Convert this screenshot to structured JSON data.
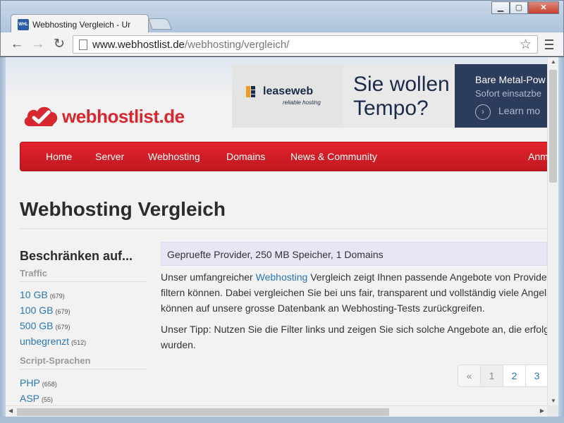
{
  "browser": {
    "tab_title": "Webhosting Vergleich - Ur",
    "favicon_text": "WHL",
    "url_domain": "www.webhostlist.de",
    "url_path": "/webhosting/vergleich/"
  },
  "site": {
    "logo_text": "webhostlist.de",
    "brand_color": "#d7282f"
  },
  "banner": {
    "brand": "leaseweb",
    "tagline": "reliable hosting",
    "headline1": "Sie wollen",
    "headline2": "Tempo?",
    "right1": "Bare Metal-Pow",
    "right2": "Sofort einsatzbe",
    "right3": "Learn mo"
  },
  "nav": {
    "items": [
      "Home",
      "Server",
      "Webhosting",
      "Domains",
      "News & Community"
    ],
    "right": "Anm"
  },
  "page_title": "Webhosting Vergleich",
  "sidebar": {
    "title": "Beschränken auf...",
    "traffic_head": "Traffic",
    "traffic": [
      {
        "label": "10 GB",
        "count": "(679)"
      },
      {
        "label": "100 GB",
        "count": "(679)"
      },
      {
        "label": "500 GB",
        "count": "(679)"
      },
      {
        "label": "unbegrenzt",
        "count": "(512)"
      }
    ],
    "script_head": "Script-Sprachen",
    "scripts": [
      {
        "label": "PHP",
        "count": "(658)"
      },
      {
        "label": "ASP",
        "count": "(55)"
      }
    ]
  },
  "main": {
    "filter_text": "Gepruefte Provider, 250 MB Speicher, 1 Domains",
    "p1_pre": "Unser umfangreicher ",
    "p1_link": "Webhosting",
    "p1_post": " Vergleich zeigt Ihnen passende Angebote von Provide",
    "p1_line2": "filtern können. Dabei vergleichen Sie bei uns fair, transparent und vollständig viele Angel",
    "p1_line3": "können auf unsere grosse Datenbank an Webhosting-Tests zurückgreifen.",
    "p2_line1": "Unser Tipp: Nutzen Sie die Filter links und zeigen Sie sich solche Angebote an, die erfolg",
    "p2_line2": "wurden."
  },
  "pagination": {
    "prev": "«",
    "pages": [
      "1",
      "2",
      "3"
    ]
  }
}
